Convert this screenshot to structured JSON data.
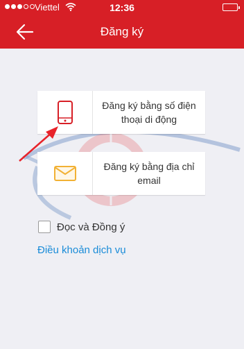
{
  "status_bar": {
    "carrier": "Viettel",
    "time": "12:36",
    "signal_bars_filled": 3,
    "signal_bars_total": 5
  },
  "nav": {
    "title": "Đăng ký",
    "back_icon": "arrow-left-icon"
  },
  "options": [
    {
      "icon": "mobile-phone-icon",
      "label": "Đăng ký bằng số điện thoại di động"
    },
    {
      "icon": "envelope-icon",
      "label": "Đăng ký bằng địa chỉ email"
    }
  ],
  "agreement": {
    "checked": false,
    "label": "Đọc và Đồng ý",
    "terms_link": "Điều khoản dịch vụ"
  },
  "colors": {
    "header": "#d71f26",
    "phone_icon": "#d71f26",
    "email_icon": "#f2b134",
    "link": "#1a8cd8",
    "annotation_arrow": "#e8232a"
  }
}
